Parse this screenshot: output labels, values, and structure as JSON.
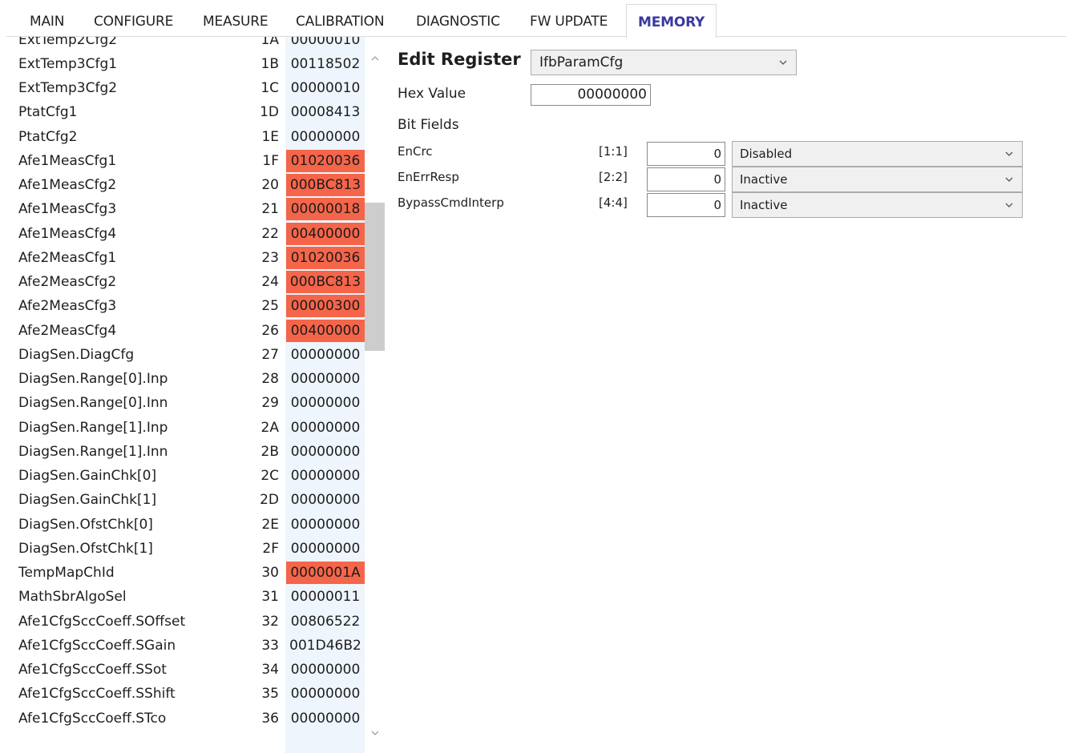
{
  "tabs": [
    "MAIN",
    "CONFIGURE",
    "MEASURE",
    "CALIBRATION",
    "DIAGNOSTIC",
    "FW UPDATE",
    "MEMORY"
  ],
  "active_tab": "MEMORY",
  "registers": [
    {
      "name": "ExtTemp2Cfg2",
      "addr": "1A",
      "value": "00000010",
      "highlighted": false
    },
    {
      "name": "ExtTemp3Cfg1",
      "addr": "1B",
      "value": "00118502",
      "highlighted": false
    },
    {
      "name": "ExtTemp3Cfg2",
      "addr": "1C",
      "value": "00000010",
      "highlighted": false
    },
    {
      "name": "PtatCfg1",
      "addr": "1D",
      "value": "00008413",
      "highlighted": false
    },
    {
      "name": "PtatCfg2",
      "addr": "1E",
      "value": "00000000",
      "highlighted": false
    },
    {
      "name": "Afe1MeasCfg1",
      "addr": "1F",
      "value": "01020036",
      "highlighted": true
    },
    {
      "name": "Afe1MeasCfg2",
      "addr": "20",
      "value": "000BC813",
      "highlighted": true
    },
    {
      "name": "Afe1MeasCfg3",
      "addr": "21",
      "value": "00000018",
      "highlighted": true
    },
    {
      "name": "Afe1MeasCfg4",
      "addr": "22",
      "value": "00400000",
      "highlighted": true
    },
    {
      "name": "Afe2MeasCfg1",
      "addr": "23",
      "value": "01020036",
      "highlighted": true
    },
    {
      "name": "Afe2MeasCfg2",
      "addr": "24",
      "value": "000BC813",
      "highlighted": true
    },
    {
      "name": "Afe2MeasCfg3",
      "addr": "25",
      "value": "00000300",
      "highlighted": true
    },
    {
      "name": "Afe2MeasCfg4",
      "addr": "26",
      "value": "00400000",
      "highlighted": true
    },
    {
      "name": "DiagSen.DiagCfg",
      "addr": "27",
      "value": "00000000",
      "highlighted": false
    },
    {
      "name": "DiagSen.Range[0].Inp",
      "addr": "28",
      "value": "00000000",
      "highlighted": false
    },
    {
      "name": "DiagSen.Range[0].Inn",
      "addr": "29",
      "value": "00000000",
      "highlighted": false
    },
    {
      "name": "DiagSen.Range[1].Inp",
      "addr": "2A",
      "value": "00000000",
      "highlighted": false
    },
    {
      "name": "DiagSen.Range[1].Inn",
      "addr": "2B",
      "value": "00000000",
      "highlighted": false
    },
    {
      "name": "DiagSen.GainChk[0]",
      "addr": "2C",
      "value": "00000000",
      "highlighted": false
    },
    {
      "name": "DiagSen.GainChk[1]",
      "addr": "2D",
      "value": "00000000",
      "highlighted": false
    },
    {
      "name": "DiagSen.OfstChk[0]",
      "addr": "2E",
      "value": "00000000",
      "highlighted": false
    },
    {
      "name": "DiagSen.OfstChk[1]",
      "addr": "2F",
      "value": "00000000",
      "highlighted": false
    },
    {
      "name": "TempMapChId",
      "addr": "30",
      "value": "0000001A",
      "highlighted": true
    },
    {
      "name": "MathSbrAlgoSel",
      "addr": "31",
      "value": "00000011",
      "highlighted": false
    },
    {
      "name": "Afe1CfgSccCoeff.SOffset",
      "addr": "32",
      "value": "00806522",
      "highlighted": false
    },
    {
      "name": "Afe1CfgSccCoeff.SGain",
      "addr": "33",
      "value": "001D46B2",
      "highlighted": false
    },
    {
      "name": "Afe1CfgSccCoeff.SSot",
      "addr": "34",
      "value": "00000000",
      "highlighted": false
    },
    {
      "name": "Afe1CfgSccCoeff.SShift",
      "addr": "35",
      "value": "00000000",
      "highlighted": false
    },
    {
      "name": "Afe1CfgSccCoeff.STco",
      "addr": "36",
      "value": "00000000",
      "highlighted": false
    }
  ],
  "highlight_color": "#f5654a",
  "editor": {
    "title": "Edit Register",
    "selected_register": "IfbParamCfg",
    "hex_label": "Hex Value",
    "hex_value": "00000000",
    "bitfields_label": "Bit Fields",
    "bitfields": [
      {
        "name": "EnCrc",
        "range": "[1:1]",
        "value": "0",
        "option": "Disabled"
      },
      {
        "name": "EnErrResp",
        "range": "[2:2]",
        "value": "0",
        "option": "Inactive"
      },
      {
        "name": "BypassCmdInterp",
        "range": "[4:4]",
        "value": "0",
        "option": "Inactive"
      }
    ]
  }
}
